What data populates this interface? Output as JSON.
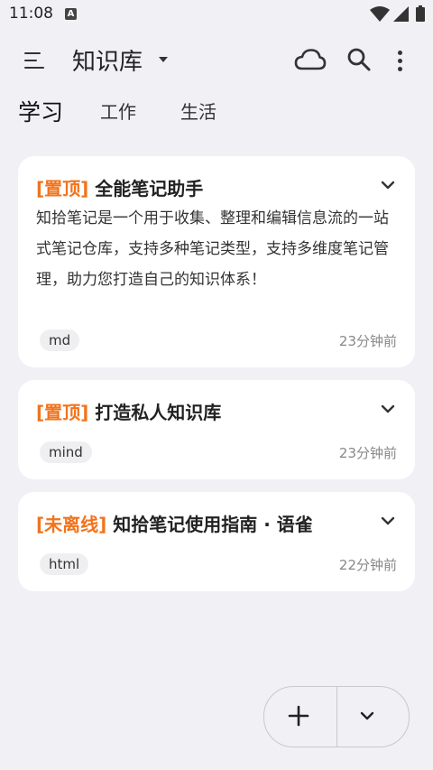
{
  "status_bar": {
    "time": "11:08",
    "notif_icon_letter": "A"
  },
  "app_bar": {
    "title": "知识库"
  },
  "tabs": [
    {
      "label": "学习",
      "active": true
    },
    {
      "label": "工作",
      "active": false
    },
    {
      "label": "生活",
      "active": false
    }
  ],
  "notes": [
    {
      "tag": "[置顶]",
      "title": "全能笔记助手",
      "body": "知拾笔记是一个用于收集、整理和编辑信息流的一站式笔记仓库，支持多种笔记类型，支持多维度笔记管理，助力您打造自己的知识体系！",
      "type": "md",
      "time": "23分钟前"
    },
    {
      "tag": "[置顶]",
      "title": "打造私人知识库",
      "type": "mind",
      "time": "23分钟前"
    },
    {
      "tag": "[未离线]",
      "title": "知拾笔记使用指南 · 语雀",
      "type": "html",
      "time": "22分钟前"
    }
  ],
  "colors": {
    "accent": "#f2731b",
    "background": "#f1f0f5",
    "card": "#ffffff"
  }
}
